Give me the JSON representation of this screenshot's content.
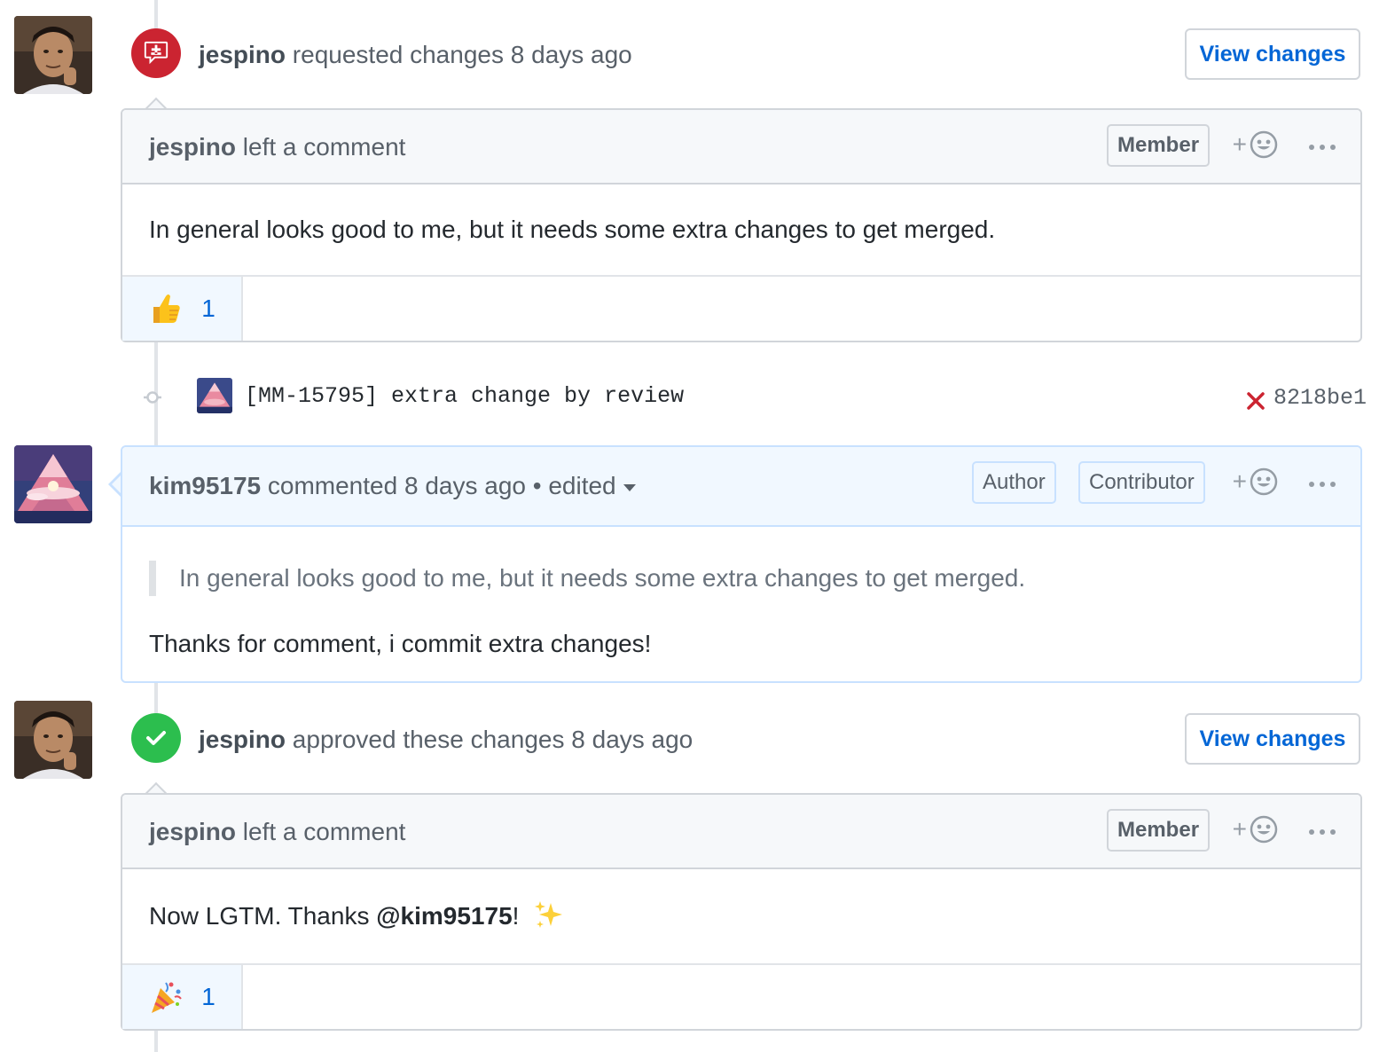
{
  "events": [
    {
      "type": "review",
      "state": "changes_requested",
      "actor": "jespino",
      "action": "requested changes",
      "time": "8 days ago",
      "view_button": "View changes",
      "comment": {
        "author": "jespino",
        "header_action": "left a comment",
        "roles": [
          "Member"
        ],
        "body": "In general looks good to me, but it needs some extra changes to get merged.",
        "reaction": {
          "emoji": "thumbs-up",
          "count": "1"
        }
      }
    },
    {
      "type": "commit",
      "message": "[MM-15795] extra change by review",
      "status": "failure",
      "sha": "8218be1"
    },
    {
      "type": "comment",
      "author": "kim95175",
      "action": "commented",
      "time": "8 days ago",
      "separator": "•",
      "edited_label": "edited",
      "roles": [
        "Author",
        "Contributor"
      ],
      "quote": "In general looks good to me, but it needs some extra changes to get merged.",
      "body": "Thanks for comment, i commit extra changes!"
    },
    {
      "type": "review",
      "state": "approved",
      "actor": "jespino",
      "action": "approved these changes",
      "time": "8 days ago",
      "view_button": "View changes",
      "comment": {
        "author": "jespino",
        "header_action": "left a comment",
        "roles": [
          "Member"
        ],
        "body_prefix": "Now LGTM. Thanks ",
        "mention": "@kim95175",
        "body_suffix": "!",
        "body_emoji": "sparkles",
        "reaction": {
          "emoji": "party-popper",
          "count": "1"
        }
      }
    }
  ],
  "reaction_add_symbol": "+",
  "colors": {
    "changes_requested": "#cb2431",
    "approved": "#2cbe4e",
    "link": "#0366d6",
    "failure": "#cb2431"
  }
}
